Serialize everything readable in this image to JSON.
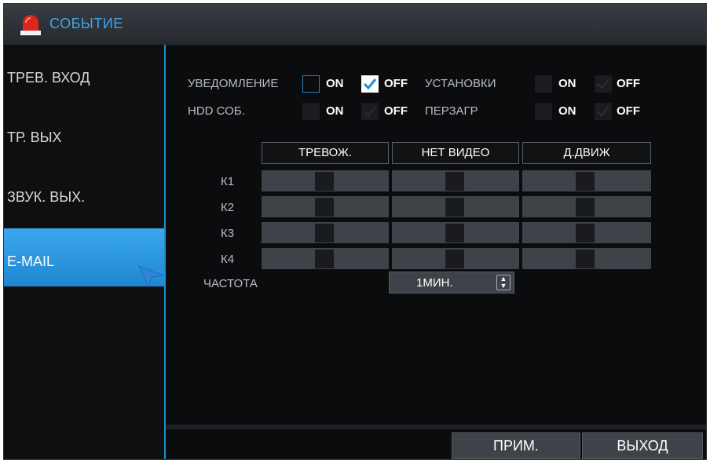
{
  "window": {
    "title": "СОБЫТИЕ",
    "title_icon": "alarm-light-icon"
  },
  "sidebar": {
    "items": [
      {
        "label": "ТРЕВ. ВХОД",
        "active": false
      },
      {
        "label": "ТР. ВЫХ",
        "active": false
      },
      {
        "label": "ЗВУК. ВЫХ.",
        "active": false
      },
      {
        "label": "E-MAIL",
        "active": true
      }
    ]
  },
  "settings": {
    "notify": {
      "label": "УВЕДОМЛЕНИЕ",
      "on": "ON",
      "off": "OFF",
      "value": "OFF"
    },
    "config": {
      "label": "УСТАНОВКИ",
      "on": "ON",
      "off": "OFF",
      "value": "OFF"
    },
    "hdd": {
      "label": "HDD СОБ.",
      "on": "ON",
      "off": "OFF",
      "value": "OFF"
    },
    "reboot": {
      "label": "ПЕРЗАГР",
      "on": "ON",
      "off": "OFF",
      "value": "OFF"
    }
  },
  "grid": {
    "columns": [
      "ТРЕВОЖ.",
      "НЕТ ВИДЕО",
      "Д.ДВИЖ"
    ],
    "rows": [
      "К1",
      "К2",
      "К3",
      "К4"
    ]
  },
  "frequency": {
    "label": "ЧАСТОТА",
    "value": "1МИН.",
    "spinner_up": "▲",
    "spinner_down": "▼"
  },
  "buttons": {
    "apply": "ПРИМ.",
    "exit": "ВЫХОД"
  },
  "colors": {
    "accent": "#1f8fd0",
    "title_text": "#3aa6e6",
    "active_item": "#2a97e0"
  }
}
